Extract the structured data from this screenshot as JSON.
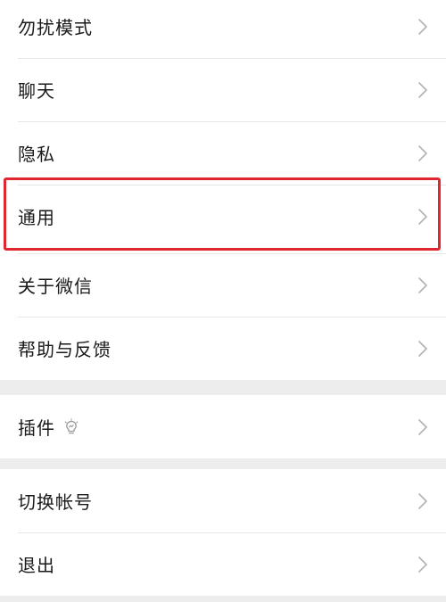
{
  "groups": [
    {
      "items": [
        {
          "label": "勿扰模式"
        },
        {
          "label": "聊天"
        },
        {
          "label": "隐私"
        },
        {
          "label": "通用"
        },
        {
          "label": "关于微信"
        },
        {
          "label": "帮助与反馈"
        }
      ]
    },
    {
      "items": [
        {
          "label": "插件"
        }
      ]
    },
    {
      "items": [
        {
          "label": "切换帐号"
        },
        {
          "label": "退出"
        }
      ]
    }
  ],
  "highlight_color": "#e0262e"
}
